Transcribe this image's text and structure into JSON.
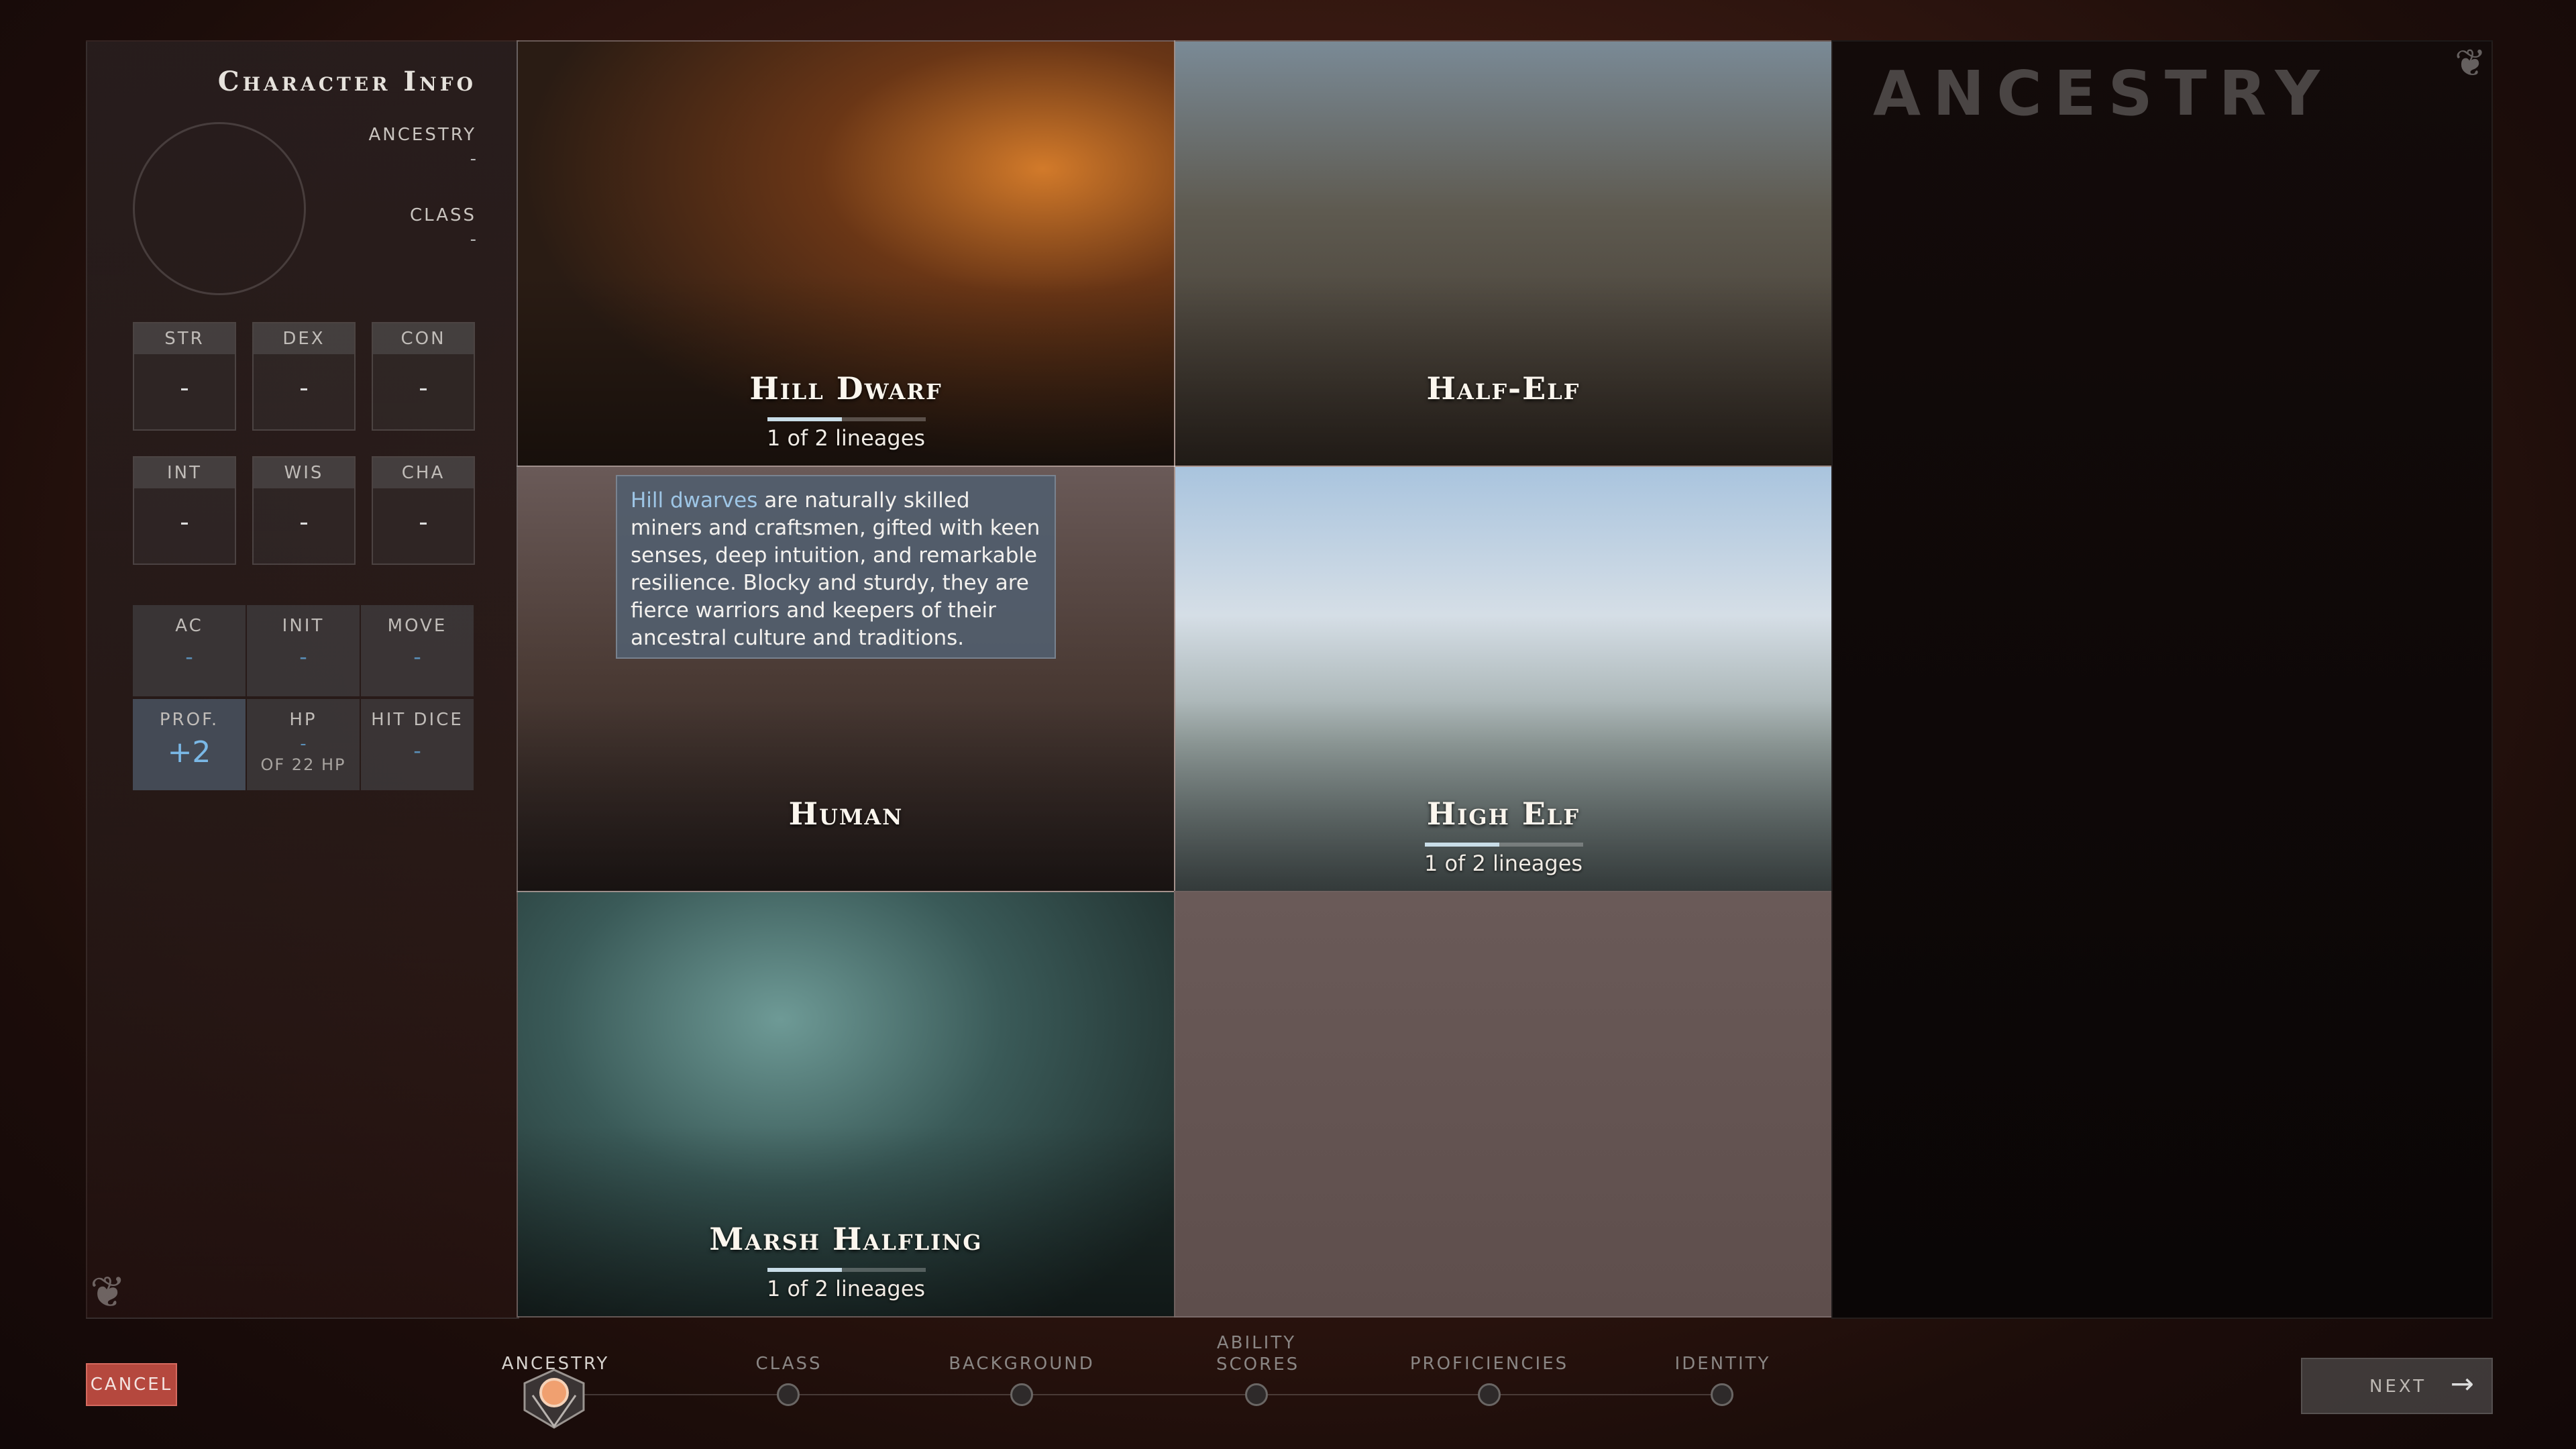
{
  "left_panel": {
    "title": "Character Info",
    "ancestry_label": "ANCESTRY",
    "ancestry_value": "-",
    "class_label": "CLASS",
    "class_value": "-",
    "abilities": [
      {
        "label": "STR",
        "value": "-"
      },
      {
        "label": "DEX",
        "value": "-"
      },
      {
        "label": "CON",
        "value": "-"
      },
      {
        "label": "INT",
        "value": "-"
      },
      {
        "label": "WIS",
        "value": "-"
      },
      {
        "label": "CHA",
        "value": "-"
      }
    ],
    "combat": [
      {
        "label": "AC",
        "value": "-"
      },
      {
        "label": "INIT",
        "value": "-"
      },
      {
        "label": "MOVE",
        "value": "-"
      },
      {
        "label": "PROF.",
        "value": "+2"
      },
      {
        "label": "HP",
        "value": "-",
        "sub": "OF 22 HP"
      },
      {
        "label": "HIT DICE",
        "value": "-"
      }
    ]
  },
  "ancestries": [
    {
      "name": "Hill Dwarf",
      "lineage_text": "1 of 2 lineages",
      "lineage_fraction": 0.5
    },
    {
      "name": "Half-Elf"
    },
    {
      "name": "Human"
    },
    {
      "name": "High Elf",
      "lineage_text": "1 of 2 lineages",
      "lineage_fraction": 0.5
    },
    {
      "name": "Marsh Halfling",
      "lineage_text": "1 of 2 lineages",
      "lineage_fraction": 0.5
    }
  ],
  "tooltip": {
    "highlight": "Hill dwarves",
    "text": " are naturally skilled miners and craftsmen, gifted with keen senses, deep intuition, and remarkable resilience. Blocky and sturdy, they are fierce warriors and keepers of their ancestral culture and traditions."
  },
  "right_panel": {
    "title": "ANCESTRY"
  },
  "footer": {
    "cancel": "CANCEL",
    "next": "NEXT",
    "steps": [
      {
        "label": "ANCESTRY",
        "active": true
      },
      {
        "label": "CLASS"
      },
      {
        "label": "BACKGROUND"
      },
      {
        "label": "ABILITY SCORES"
      },
      {
        "label": "PROFICIENCIES"
      },
      {
        "label": "IDENTITY"
      }
    ]
  }
}
